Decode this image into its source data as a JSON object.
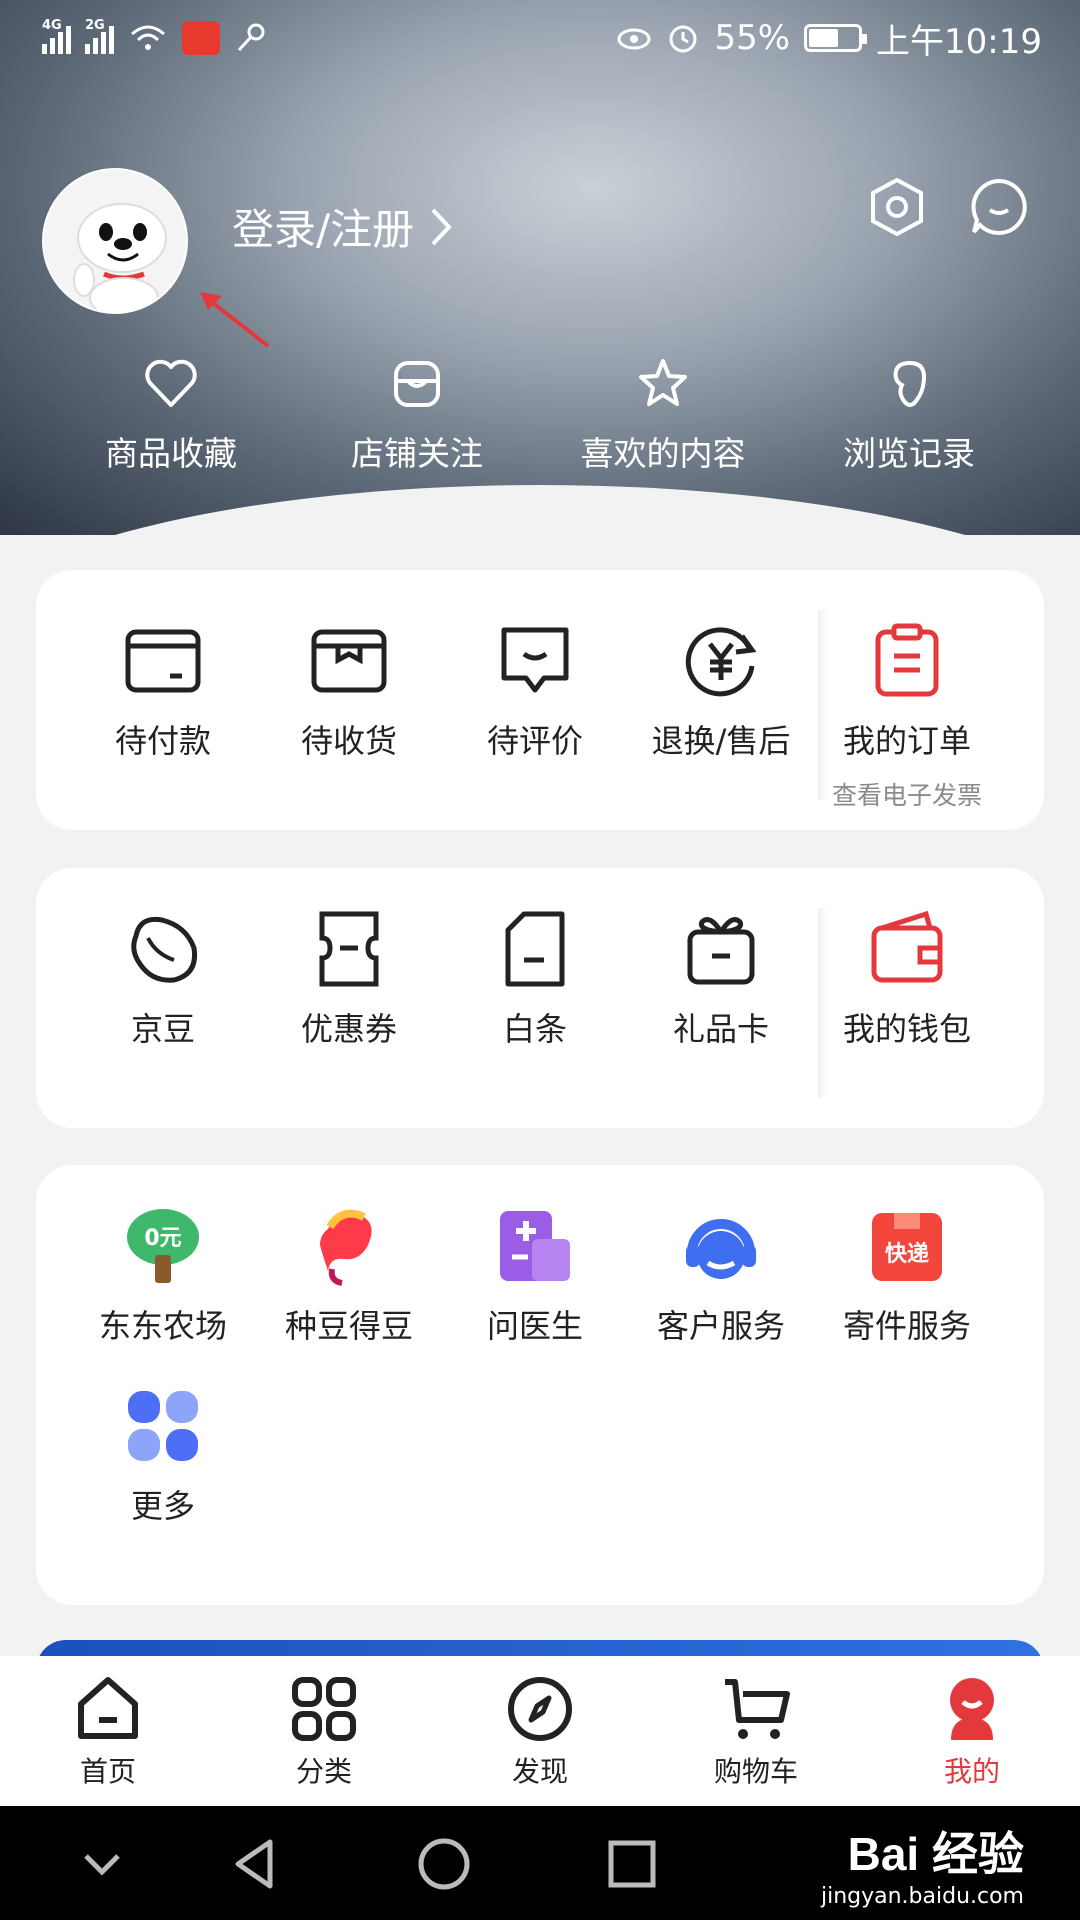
{
  "status_bar": {
    "signal1_tag": "4G",
    "signal2_tag": "2G",
    "battery_percent": "55%",
    "battery_level": 0.55,
    "time": "上午10:19"
  },
  "profile": {
    "login_label": "登录/注册",
    "avatar_icon": "jd-dog-mascot-avatar",
    "settings_icon": "settings-hexagon-icon",
    "message_icon": "message-bubble-icon"
  },
  "quick_links": [
    {
      "label": "商品收藏",
      "icon": "heart-icon"
    },
    {
      "label": "店铺关注",
      "icon": "store-icon"
    },
    {
      "label": "喜欢的内容",
      "icon": "star-icon"
    },
    {
      "label": "浏览记录",
      "icon": "footprint-icon"
    }
  ],
  "orders": {
    "items": [
      {
        "label": "待付款",
        "icon": "wallet-card-icon"
      },
      {
        "label": "待收货",
        "icon": "package-box-icon"
      },
      {
        "label": "待评价",
        "icon": "comment-icon"
      },
      {
        "label": "退换/售后",
        "icon": "refund-yen-icon"
      }
    ],
    "featured": {
      "label": "我的订单",
      "sub": "查看电子发票",
      "icon": "clipboard-icon"
    }
  },
  "wallet": {
    "items": [
      {
        "label": "京豆",
        "icon": "bean-icon"
      },
      {
        "label": "优惠券",
        "icon": "coupon-icon"
      },
      {
        "label": "白条",
        "icon": "document-icon"
      },
      {
        "label": "礼品卡",
        "icon": "gift-icon"
      }
    ],
    "featured": {
      "label": "我的钱包",
      "icon": "wallet-icon"
    }
  },
  "services": {
    "items": [
      {
        "label": "东东农场",
        "icon": "tree-icon",
        "badge": "0元"
      },
      {
        "label": "种豆得豆",
        "icon": "bean-swirl-icon"
      },
      {
        "label": "问医生",
        "icon": "medical-icon"
      },
      {
        "label": "客户服务",
        "icon": "headset-icon"
      },
      {
        "label": "寄件服务",
        "icon": "express-box-icon",
        "badge": "快递"
      },
      {
        "label": "更多",
        "icon": "more-grid-icon"
      }
    ]
  },
  "tabbar": {
    "items": [
      {
        "label": "首页",
        "icon": "home-icon"
      },
      {
        "label": "分类",
        "icon": "category-grid-icon"
      },
      {
        "label": "发现",
        "icon": "compass-icon"
      },
      {
        "label": "购物车",
        "icon": "cart-icon"
      },
      {
        "label": "我的",
        "icon": "profile-mascot-icon"
      }
    ]
  },
  "watermark": {
    "line1": "Bai 经验",
    "line2": "jingyan.baidu.com"
  },
  "colors": {
    "accent": "#e4393c",
    "card_bg": "#ffffff",
    "page_bg": "#f2f2f2"
  }
}
